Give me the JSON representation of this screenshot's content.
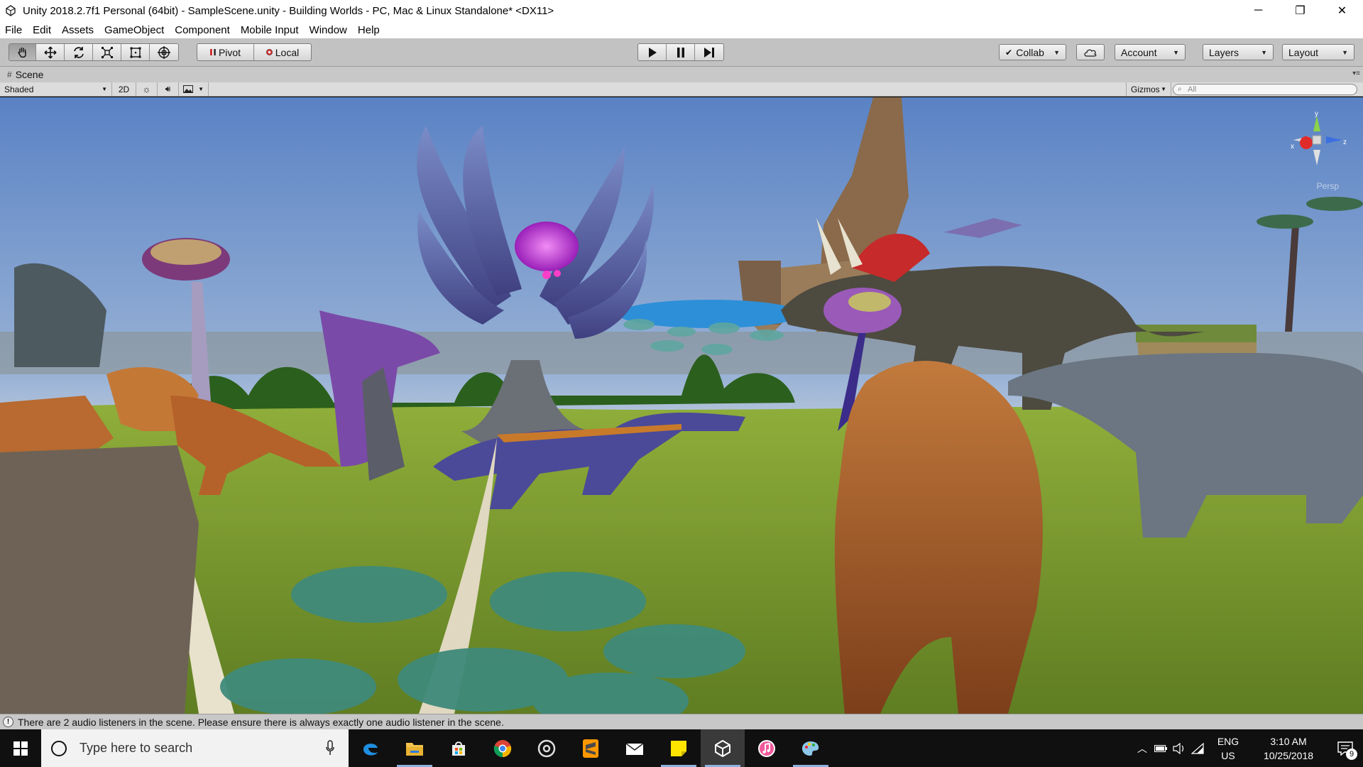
{
  "window": {
    "title": "Unity 2018.2.7f1 Personal (64bit) - SampleScene.unity - Building Worlds - PC, Mac & Linux Standalone* <DX11>",
    "controls": {
      "minimize": "─",
      "restore": "❐",
      "close": "✕"
    }
  },
  "menu": {
    "items": [
      "File",
      "Edit",
      "Assets",
      "GameObject",
      "Component",
      "Mobile Input",
      "Window",
      "Help"
    ]
  },
  "toolbar": {
    "pivot_label": "Pivot",
    "local_label": "Local",
    "collab_label": "Collab",
    "account_label": "Account",
    "layers_label": "Layers",
    "layout_label": "Layout"
  },
  "scene": {
    "tab_label": "Scene",
    "shading_mode": "Shaded",
    "mode_2d": "2D",
    "gizmos_label": "Gizmos",
    "search_placeholder": "All",
    "gizmo_axes": {
      "y": "y",
      "x": "x",
      "z": "z"
    },
    "projection_label": "Persp"
  },
  "status": {
    "message": "There are 2 audio listeners in the scene. Please ensure there is always exactly one audio listener in the scene."
  },
  "taskbar": {
    "search_placeholder": "Type here to search",
    "apps": [
      "edge-icon",
      "file-explorer-icon",
      "store-icon",
      "chrome-icon",
      "media-icon",
      "sublime-icon",
      "mail-icon",
      "sticky-notes-icon",
      "unity-icon",
      "itunes-icon",
      "paint-icon"
    ],
    "language_line1": "ENG",
    "language_line2": "US",
    "time": "3:10 AM",
    "date": "10/25/2018",
    "notification_count": "9"
  },
  "colors": {
    "toolbar_bg": "#c2c2c2",
    "sky_top": "#5f86c6",
    "sky_horizon": "#c9d4e0",
    "ground": "#7c9a2c",
    "taskbar_bg": "#101010"
  }
}
